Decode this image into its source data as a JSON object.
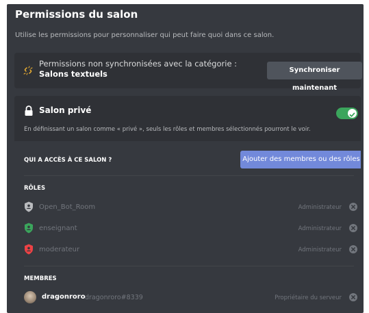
{
  "header": {
    "title": "Permissions du salon",
    "subtitle": "Utilise les permissions pour personnaliser qui peut faire quoi dans ce salon."
  },
  "sync": {
    "text_prefix": "Permissions non synchronisées avec la catégorie : ",
    "category": "Salons textuels",
    "button_label": "Synchroniser maintenant",
    "icon": "unlink-icon"
  },
  "private": {
    "title": "Salon privé",
    "description": "En définissant un salon comme « privé », seuls les rôles et membres sélectionnés pourront le voir.",
    "enabled": true,
    "toggle_color": "#3ba55c"
  },
  "access": {
    "label": "QUI A ACCÈS À CE SALON ?",
    "add_button_label": "Ajouter des membres ou des rôles",
    "add_button_color": "#7289da"
  },
  "roles": {
    "label": "RÔLES",
    "items": [
      {
        "name": "Open_Bot_Room",
        "permission": "Administrateur",
        "color": "#b9bbbe"
      },
      {
        "name": "enseignant",
        "permission": "Administrateur",
        "color": "#3ba55c"
      },
      {
        "name": "moderateur",
        "permission": "Administrateur",
        "color": "#ed4245"
      }
    ]
  },
  "members": {
    "label": "MEMBRES",
    "items": [
      {
        "name": "dragonroro",
        "tag": "dragonroro#8339",
        "permission": "Propriétaire du serveur"
      }
    ]
  }
}
